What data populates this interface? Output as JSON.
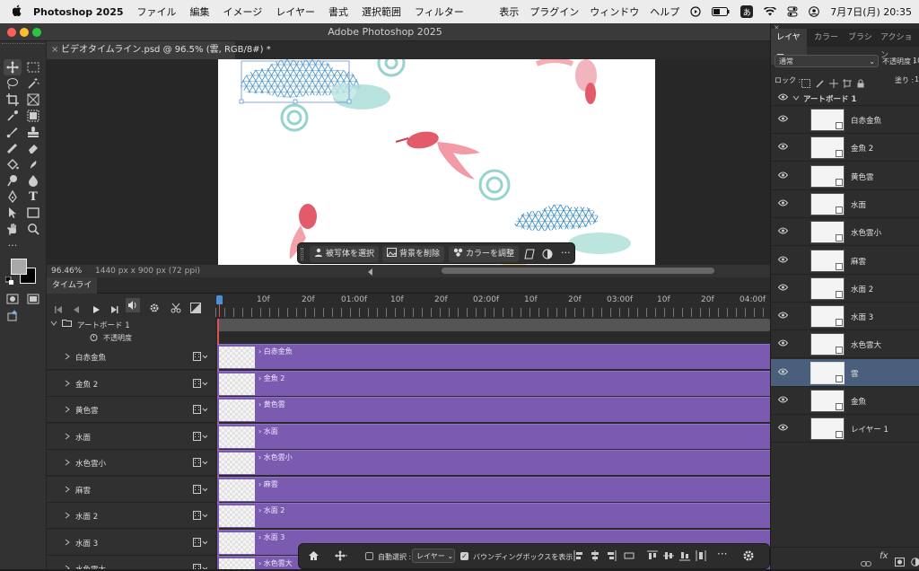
{
  "menubar": {
    "app_name": "Photoshop 2025",
    "items": [
      "ファイル",
      "編集",
      "イメージ",
      "レイヤー",
      "書式",
      "選択範囲",
      "フィルター"
    ],
    "right_items": [
      "表示",
      "プラグイン",
      "ウィンドウ",
      "ヘルプ"
    ],
    "input_method": "あ",
    "datetime": "7月7日(月)  20:35"
  },
  "window": {
    "title": "Adobe Photoshop 2025",
    "doc_tab": "ビデオタイムライン.psd @ 96.5% (雲, RGB/8#) *"
  },
  "status": {
    "zoom": "96.46%",
    "doc_info": "1440 px x 900 px (72 ppi)"
  },
  "context_bar": {
    "select_subject": "被写体を選択",
    "remove_bg": "背景を削除",
    "adjust_color": "カラーを調整"
  },
  "timeline": {
    "tab": "タイムライン",
    "ruler_labels": [
      "10f",
      "20f",
      "01:00f",
      "10f",
      "20f",
      "02:00f",
      "10f",
      "20f",
      "03:00f",
      "10f",
      "20f",
      "04:00f"
    ],
    "group_name": "アートボード 1",
    "opacity_label": "不透明度",
    "tracks": [
      {
        "name": "白赤金魚",
        "clip": "白赤金魚"
      },
      {
        "name": "金魚 2",
        "clip": "金魚 2"
      },
      {
        "name": "黄色雲",
        "clip": "黄色雲"
      },
      {
        "name": "水面",
        "clip": "水面"
      },
      {
        "name": "水色雲小",
        "clip": "水色雲小"
      },
      {
        "name": "麻雲",
        "clip": "麻雲"
      },
      {
        "name": "水面 2",
        "clip": "水面 2"
      },
      {
        "name": "水面 3",
        "clip": "水面 3"
      },
      {
        "name": "水色雲大",
        "clip": "水色雲大"
      }
    ]
  },
  "options_bar": {
    "auto_select_label": "自動選択 :",
    "auto_select_value": "レイヤー",
    "bbox_label": "バウンディングボックスを表示"
  },
  "layers_panel": {
    "tabs": [
      "レイヤー",
      "カラー",
      "ブラシ",
      "アクション"
    ],
    "blend_mode": "通常",
    "opacity_label": "不透明度 :",
    "opacity_value": "10",
    "lock_label": "ロック :",
    "fill_label": "塗り :",
    "fill_value": "1",
    "artboard": "アートボード 1",
    "layers": [
      "白赤金魚",
      "金魚 2",
      "黄色雲",
      "水面",
      "水色雲小",
      "麻雲",
      "水面 2",
      "水面 3",
      "水色雲大",
      "雲",
      "金魚",
      "レイヤー 1"
    ],
    "selected_index": 9
  },
  "colors": {
    "clip_purple": "#7a5bb0",
    "selected_layer": "#4a5f7c",
    "fish_red": "#e35a6a",
    "wave_teal": "#7cc9c0",
    "asanoha_blue": "#3f8fc4"
  }
}
